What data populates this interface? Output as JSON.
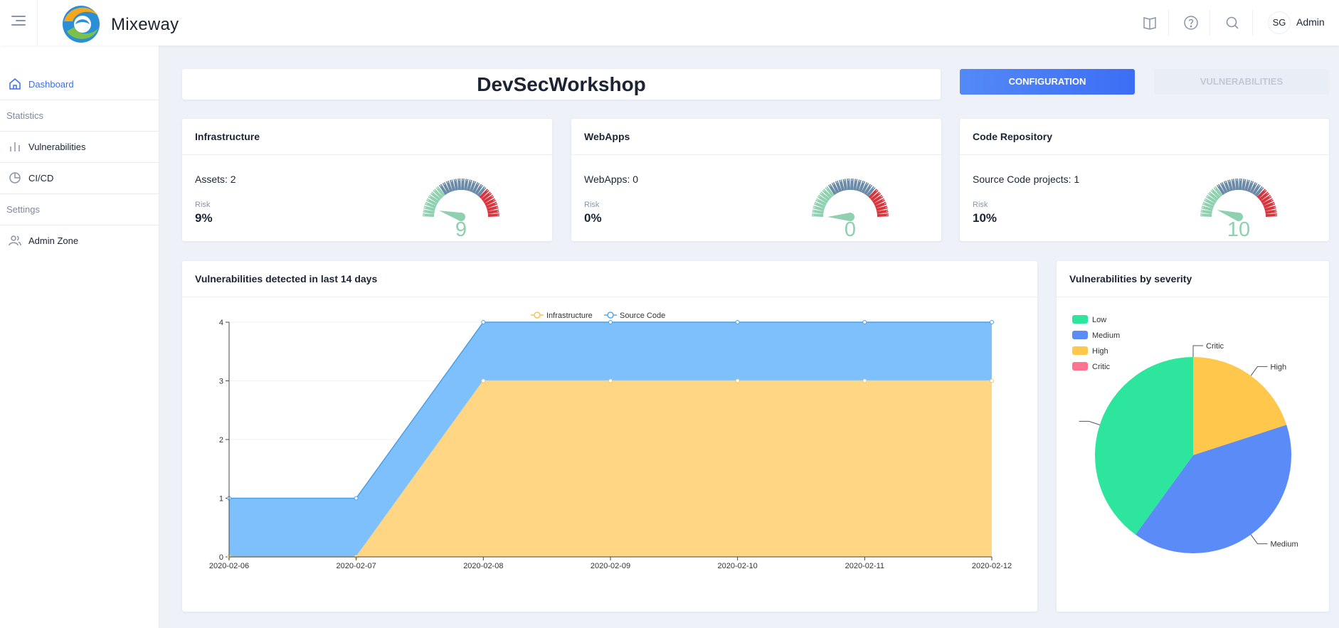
{
  "header": {
    "brand": "Mixeway",
    "avatar_initials": "SG",
    "username": "Admin",
    "icons": [
      "menu-icon",
      "book-icon",
      "help-icon",
      "search-icon"
    ]
  },
  "sidebar": {
    "items": [
      {
        "label": "Dashboard",
        "icon": "home-icon",
        "active": true
      },
      {
        "label": "Statistics",
        "type": "heading"
      },
      {
        "label": "Vulnerabilities",
        "icon": "bar-chart-icon"
      },
      {
        "label": "CI/CD",
        "icon": "pie-chart-icon"
      },
      {
        "label": "Settings",
        "type": "heading"
      },
      {
        "label": "Admin Zone",
        "icon": "users-icon"
      }
    ]
  },
  "page": {
    "title": "DevSecWorkshop",
    "config_button": "CONFIGURATION",
    "vuln_button": "VULNERABILITIES"
  },
  "colors": {
    "accent": "#3b6ef5",
    "infrastructure": "#ffd683",
    "source_code": "#7ec0fb",
    "low": "#2ee59d",
    "medium": "#5b8bf7",
    "high": "#ffc84d",
    "critic": "#ff7590"
  },
  "summary": [
    {
      "title": "Infrastructure",
      "stat": "Assets: 2",
      "risk_label": "Risk",
      "risk": "9%",
      "gauge_value": "9"
    },
    {
      "title": "WebApps",
      "stat": "WebApps: 0",
      "risk_label": "Risk",
      "risk": "0%",
      "gauge_value": "0"
    },
    {
      "title": "Code Repository",
      "stat": "Source Code projects: 1",
      "risk_label": "Risk",
      "risk": "10%",
      "gauge_value": "10"
    }
  ],
  "trend": {
    "title": "Vulnerabilities detected in last 14 days"
  },
  "severity": {
    "title": "Vulnerabilities by severity"
  },
  "chart_data": [
    {
      "type": "area",
      "title": "Vulnerabilities detected in last 14 days",
      "stacked": true,
      "categories": [
        "2020-02-06",
        "2020-02-07",
        "2020-02-08",
        "2020-02-09",
        "2020-02-10",
        "2020-02-11",
        "2020-02-12"
      ],
      "series": [
        {
          "name": "Infrastructure",
          "values": [
            0,
            0,
            3,
            3,
            3,
            3,
            3
          ]
        },
        {
          "name": "Source Code",
          "values": [
            1,
            1,
            1,
            1,
            1,
            1,
            1
          ]
        }
      ],
      "y_ticks": [
        "0",
        "1",
        "2",
        "3",
        "4"
      ],
      "ylim": [
        0,
        4
      ],
      "grid": true,
      "legend": "top-center"
    },
    {
      "type": "pie",
      "title": "Vulnerabilities by severity",
      "labels": [
        "Low",
        "Medium",
        "High",
        "Critic"
      ],
      "values": [
        4,
        4,
        2,
        0
      ],
      "legend": "top-left"
    }
  ]
}
